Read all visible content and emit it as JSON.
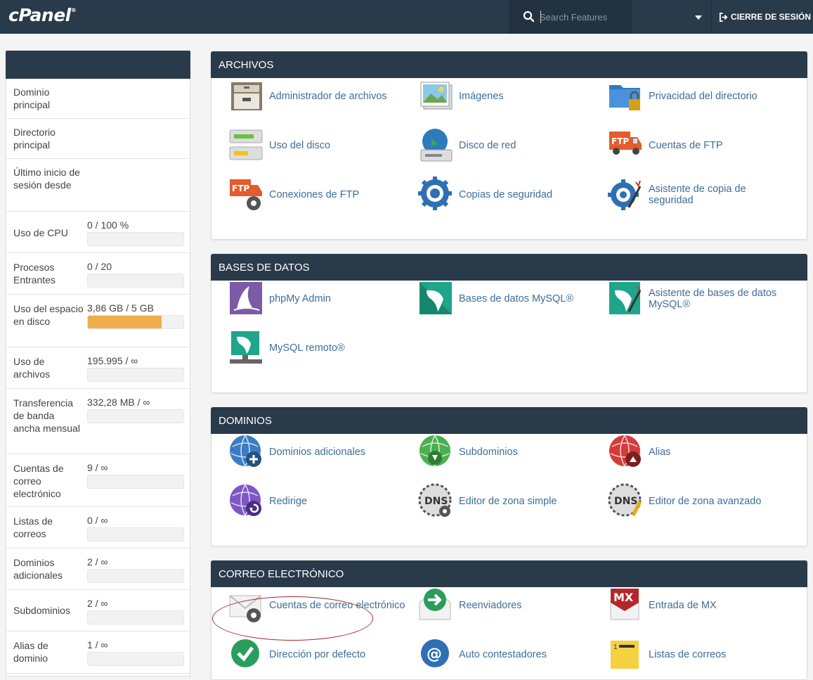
{
  "app": {
    "logo": "cPanel",
    "logo_mark": "®",
    "search_placeholder": "Search Features",
    "logout_label": "CIERRE DE SESIÓN"
  },
  "stats": [
    {
      "label": "Dominio principal",
      "value": ""
    },
    {
      "label": "Directorio principal",
      "value": ""
    },
    {
      "label": "Último inicio de sesión desde",
      "value": ""
    },
    {
      "label": "Uso de CPU",
      "value": "0 / 100 %",
      "progress": 0
    },
    {
      "label": "Procesos Entrantes",
      "value": "0 / 20",
      "progress": 0
    },
    {
      "label": "Uso del espacio en disco",
      "value": "3,86 GB / 5 GB",
      "progress": 0.77
    },
    {
      "label": "Uso de archivos",
      "value": "195.995 / ∞",
      "progress": 0
    },
    {
      "label": "Transferencia de banda ancha mensual",
      "value": "332,28 MB / ∞",
      "progress": 0
    },
    {
      "label": "Cuentas de correo electrónico",
      "value": "9 / ∞",
      "progress": 0
    },
    {
      "label": "Listas de correos",
      "value": "0 / ∞",
      "progress": 0
    },
    {
      "label": "Dominios adicionales",
      "value": "2 / ∞",
      "progress": 0
    },
    {
      "label": "Subdominios",
      "value": "2 / ∞",
      "progress": 0
    },
    {
      "label": "Alias de dominio",
      "value": "1 / ∞",
      "progress": 0
    }
  ],
  "sections": {
    "archivos": {
      "title": "ARCHIVOS",
      "items": [
        {
          "label": "Administrador de archivos",
          "icon": "file-cabinet-icon"
        },
        {
          "label": "Imágenes",
          "icon": "images-icon"
        },
        {
          "label": "Privacidad del directorio",
          "icon": "folder-lock-icon"
        },
        {
          "label": "Uso del disco",
          "icon": "disk-usage-icon"
        },
        {
          "label": "Disco de red",
          "icon": "network-disk-icon"
        },
        {
          "label": "Cuentas de FTP",
          "icon": "ftp-truck-icon"
        },
        {
          "label": "Conexiones de FTP",
          "icon": "ftp-connections-icon"
        },
        {
          "label": "Copias de seguridad",
          "icon": "backup-gear-icon"
        },
        {
          "label": "Asistente de copia de seguridad",
          "icon": "backup-wizard-icon"
        }
      ]
    },
    "bases": {
      "title": "BASES DE DATOS",
      "items": [
        {
          "label": "phpMy Admin",
          "icon": "phpmyadmin-icon"
        },
        {
          "label": "Bases de datos MySQL®",
          "icon": "mysql-dolphin-icon"
        },
        {
          "label": "Asistente de bases de datos MySQL®",
          "icon": "mysql-wizard-icon"
        },
        {
          "label": "MySQL remoto®",
          "icon": "remote-mysql-icon"
        }
      ]
    },
    "dominios": {
      "title": "DOMINIOS",
      "items": [
        {
          "label": "Dominios adicionales",
          "icon": "globe-add-icon"
        },
        {
          "label": "Subdominios",
          "icon": "globe-sub-icon"
        },
        {
          "label": "Alias",
          "icon": "globe-alias-icon"
        },
        {
          "label": "Redirige",
          "icon": "globe-redirect-icon"
        },
        {
          "label": "Editor de zona simple",
          "icon": "dns-simple-icon"
        },
        {
          "label": "Editor de zona avanzado",
          "icon": "dns-advanced-icon"
        }
      ]
    },
    "correo": {
      "title": "CORREO ELECTRÓNICO",
      "items": [
        {
          "label": "Cuentas de correo electrónico",
          "icon": "email-accounts-icon"
        },
        {
          "label": "Reenviadores",
          "icon": "forwarders-icon"
        },
        {
          "label": "Entrada de MX",
          "icon": "mx-entry-icon"
        },
        {
          "label": "Dirección por defecto",
          "icon": "default-address-icon"
        },
        {
          "label": "Auto contestadores",
          "icon": "autoresponder-icon"
        },
        {
          "label": "Listas de correos",
          "icon": "mailing-lists-icon"
        }
      ]
    }
  },
  "colors": {
    "topbar": "#293a4a",
    "link": "#3d6e9b",
    "progress_fill": "#f0ad4e",
    "highlight": "#a62828"
  }
}
